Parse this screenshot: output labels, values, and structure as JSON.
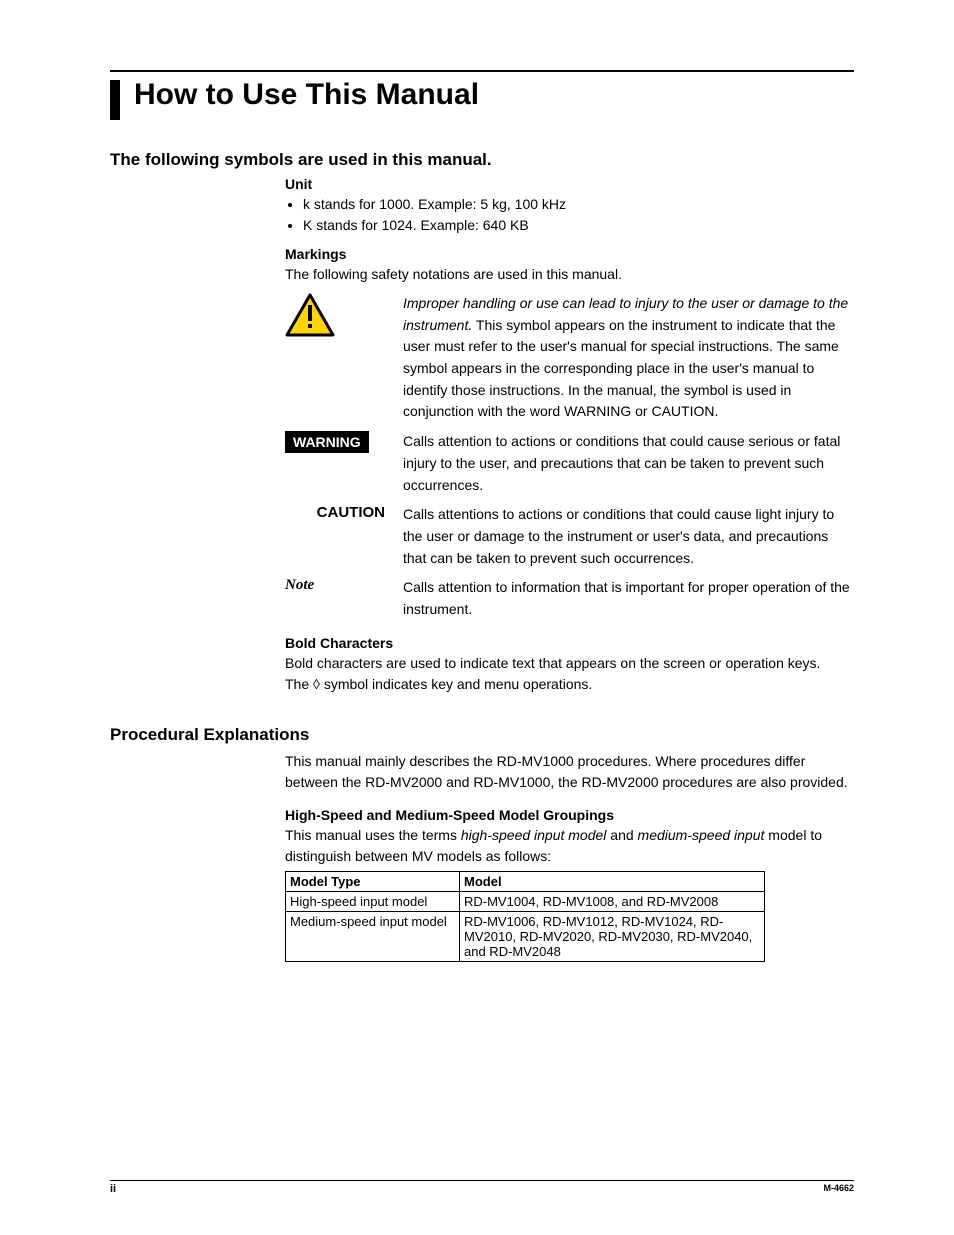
{
  "title": "How to Use This Manual",
  "s1": {
    "heading": "The following symbols are used in this manual.",
    "unit": {
      "heading": "Unit",
      "b1": "k stands for 1000. Example: 5 kg, 100 kHz",
      "b2": "K stands for 1024. Example: 640 KB"
    },
    "markings": {
      "heading": "Markings",
      "intro": "The following safety notations are used in this manual.",
      "warn_icon": {
        "italic": "Improper handling or use can lead to injury to the user or damage to the instrument.",
        "rest": " This symbol appears on the instrument to indicate that the user must refer to the user's manual for special instructions. The same symbol appears in the corresponding place in the user's manual to identify those instructions. In the manual, the symbol is used in conjunction with the word WARNING or CAUTION."
      },
      "warning": {
        "label": "WARNING",
        "body": "Calls attention to actions or conditions that could cause serious or fatal injury to the user, and precautions that can be taken to prevent such occurrences."
      },
      "caution": {
        "label": "CAUTION",
        "body": "Calls attentions to actions or conditions that could cause light injury to the user or damage to the instrument or user's data, and precautions that can be taken to prevent such occurrences."
      },
      "note": {
        "label": "Note",
        "body": "Calls attention to information that is important for proper operation of the instrument."
      }
    },
    "bold": {
      "heading": "Bold Characters",
      "line1": "Bold characters are used to indicate text that appears on the screen or operation keys.",
      "line2_pre": "The ",
      "line2_sym": "◊",
      "line2_post": " symbol indicates key and menu operations."
    }
  },
  "s2": {
    "heading": "Procedural Explanations",
    "intro": "This manual mainly describes the RD-MV1000 procedures. Where procedures differ between the RD-MV2000 and RD-MV1000, the RD-MV2000 procedures are also provided.",
    "groupings": {
      "heading": "High-Speed and Medium-Speed Model Groupings",
      "intro_pre": "This manual uses the terms ",
      "intro_em1": "high-speed input model",
      "intro_mid": " and ",
      "intro_em2": "medium-speed input",
      "intro_post": " model to distinguish between MV models as follows:"
    }
  },
  "table": {
    "h1": "Model Type",
    "h2": "Model",
    "r1c1": "High-speed input model",
    "r1c2": "RD-MV1004, RD-MV1008, and RD-MV2008",
    "r2c1": "Medium-speed input model",
    "r2c2": "RD-MV1006, RD-MV1012, RD-MV1024, RD-MV2010, RD-MV2020, RD-MV2030, RD-MV2040, and RD-MV2048"
  },
  "footer": {
    "left": "ii",
    "right": "M-4662"
  }
}
